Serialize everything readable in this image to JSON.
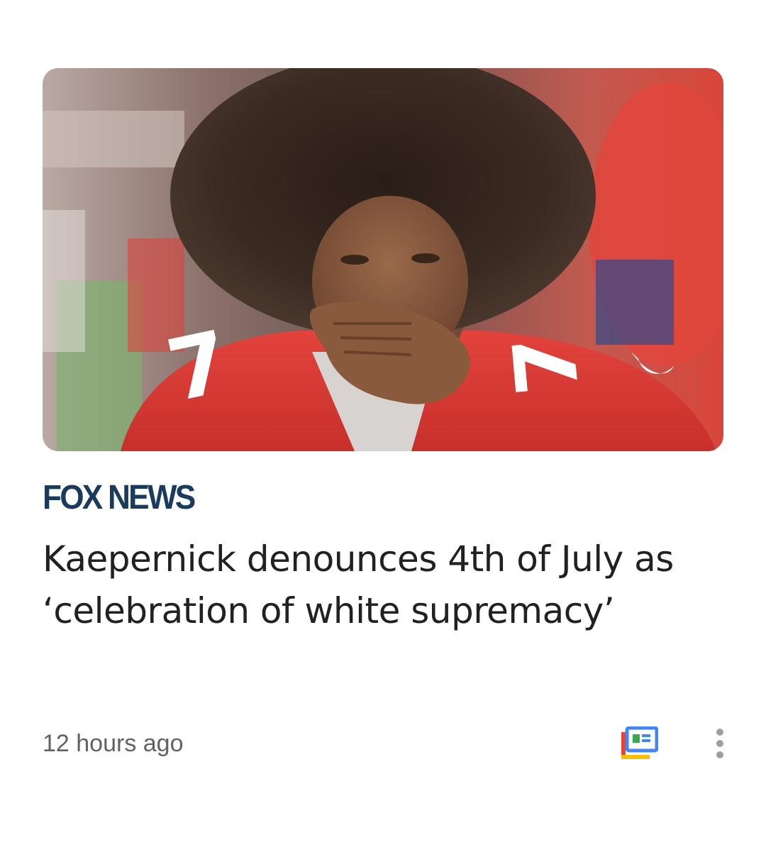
{
  "article": {
    "image_alt": "Photo of football player in red #7 jersey with hand on chin",
    "publisher": "FOX NEWS",
    "headline": "Kaepernick denounces 4th of July as ‘celebration of white supremacy’",
    "timestamp": "12 hours ago"
  },
  "actions": {
    "news_icon": "google-news-icon",
    "more_icon": "more-vert-icon"
  },
  "colors": {
    "publisher": "#1b3a5c",
    "headline": "#202124",
    "meta": "#5f6368"
  }
}
